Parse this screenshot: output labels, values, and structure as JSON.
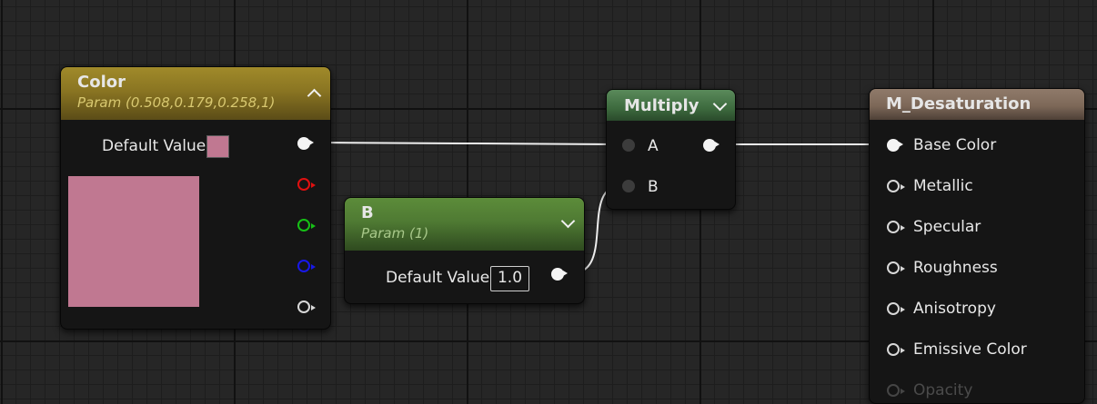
{
  "colors": {
    "background": "#262626",
    "wire": "#eeeeee",
    "param_color": "#c07891",
    "color_header": "#8a7522",
    "scalar_header": "#4f7a33",
    "multiply_header": "#3d6a3e",
    "result_header": "#7d6858"
  },
  "color_node": {
    "title": "Color",
    "subtitle": "Param (0.508,0.179,0.258,1)",
    "default_label": "Default Value",
    "collapse_icon": "chevron-up-icon",
    "output_pins": [
      "rgb",
      "red",
      "green",
      "blue",
      "alpha"
    ]
  },
  "b_node": {
    "title": "B",
    "subtitle": "Param (1)",
    "default_label": "Default Value",
    "default_value": "1.0",
    "expand_icon": "chevron-down-icon"
  },
  "multiply_node": {
    "title": "Multiply",
    "input_a": "A",
    "input_b": "B",
    "expand_icon": "chevron-down-icon"
  },
  "result_node": {
    "title": "M_Desaturation",
    "inputs": [
      "Base Color",
      "Metallic",
      "Specular",
      "Roughness",
      "Anisotropy",
      "Emissive Color",
      "Opacity"
    ]
  },
  "connections": [
    {
      "from": "Color.RGB",
      "to": "Multiply.A"
    },
    {
      "from": "B.Value",
      "to": "Multiply.B"
    },
    {
      "from": "Multiply.Output",
      "to": "M_Desaturation.Base Color"
    }
  ]
}
